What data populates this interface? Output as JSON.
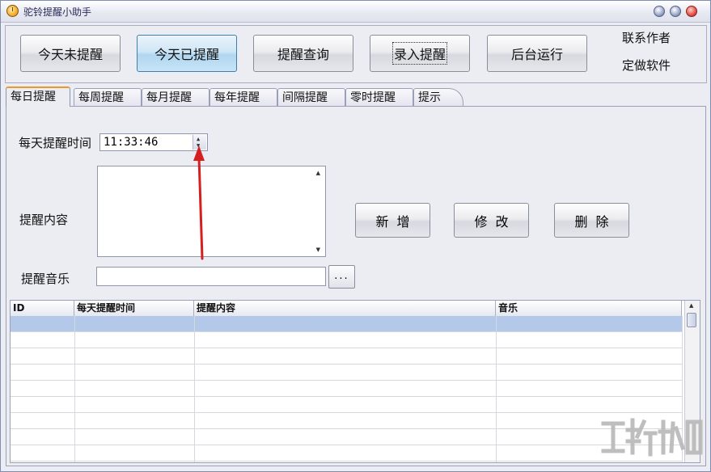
{
  "window": {
    "title": "驼铃提醒小助手"
  },
  "top_buttons": [
    {
      "label": "今天未提醒",
      "state": "normal"
    },
    {
      "label": "今天已提醒",
      "state": "active"
    },
    {
      "label": "提醒查询",
      "state": "normal"
    },
    {
      "label": "录入提醒",
      "state": "focused"
    },
    {
      "label": "后台运行",
      "state": "normal"
    }
  ],
  "side_links": {
    "contact": "联系作者",
    "custom": "定做软件"
  },
  "tabs": [
    {
      "label": "每日提醒",
      "selected": true
    },
    {
      "label": "每周提醒",
      "selected": false
    },
    {
      "label": "每月提醒",
      "selected": false
    },
    {
      "label": "每年提醒",
      "selected": false
    },
    {
      "label": "间隔提醒",
      "selected": false
    },
    {
      "label": "零时提醒",
      "selected": false
    },
    {
      "label": "提示",
      "selected": false
    }
  ],
  "form": {
    "time_label": "每天提醒时间",
    "time_value": "11:33:46",
    "content_label": "提醒内容",
    "content_value": "",
    "music_label": "提醒音乐",
    "music_value": "",
    "browse_label": "..."
  },
  "actions": {
    "add": "新增",
    "edit": "修改",
    "delete": "删除"
  },
  "table": {
    "columns": [
      "ID",
      "每天提醒时间",
      "提醒内容",
      "音乐"
    ],
    "rows": [],
    "selected_row": 0
  },
  "annotation": {
    "arrow_color": "#d42020"
  },
  "colors": {
    "tab_accent": "#e89a2a",
    "selected_row": "#b4c8ea",
    "active_button": "#b0d6f0"
  }
}
